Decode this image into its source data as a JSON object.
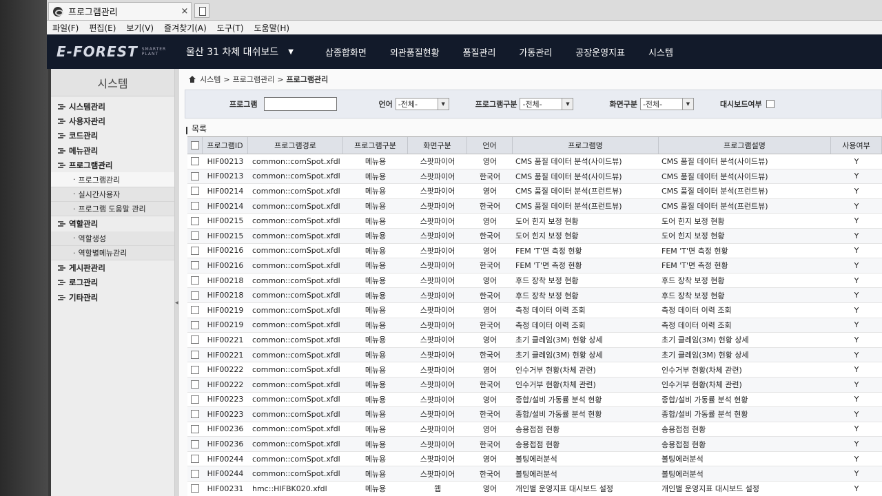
{
  "browser": {
    "tab_title": "프로그램관리",
    "tab_close": "×",
    "menu": [
      "파일(F)",
      "편집(E)",
      "보기(V)",
      "즐겨찾기(A)",
      "도구(T)",
      "도움말(H)"
    ]
  },
  "app": {
    "logo": "E-FOREST",
    "logo_sub_1": "SMARTER",
    "logo_sub_2": "PLANT",
    "dashboard": "울산 31 차체 대쉬보드",
    "nav": [
      "삽종합화면",
      "외관품질현황",
      "품질관리",
      "가동관리",
      "공장운영지표",
      "시스템"
    ]
  },
  "sidebar": {
    "title": "시스템",
    "items": [
      {
        "label": "시스템관리",
        "level": 1
      },
      {
        "label": "사용자관리",
        "level": 1
      },
      {
        "label": "코드관리",
        "level": 1
      },
      {
        "label": "메뉴관리",
        "level": 1
      },
      {
        "label": "프로그램관리",
        "level": 1
      },
      {
        "label": "프로그램관리",
        "level": 2,
        "active": true
      },
      {
        "label": "실시간사용자",
        "level": 2
      },
      {
        "label": "프로그램 도움말 관리",
        "level": 2
      },
      {
        "label": "역할관리",
        "level": 1
      },
      {
        "label": "역할생성",
        "level": 2
      },
      {
        "label": "역할별메뉴관리",
        "level": 2
      },
      {
        "label": "게시판관리",
        "level": 1
      },
      {
        "label": "로그관리",
        "level": 1
      },
      {
        "label": "기타관리",
        "level": 1
      }
    ]
  },
  "breadcrumb": {
    "a": "시스템",
    "b": "프로그램관리",
    "c": "프로그램관리",
    "sep": ">"
  },
  "search": {
    "program_label": "프로그램",
    "program_value": "",
    "lang_label": "언어",
    "lang_value": "-전체-",
    "ptype_label": "프로그램구분",
    "ptype_value": "-전체-",
    "screen_label": "화면구분",
    "screen_value": "-전체-",
    "dash_label": "대시보드여부"
  },
  "list": {
    "title": "목록",
    "headers": [
      "프로그램ID",
      "프로그램경로",
      "프로그램구분",
      "화면구분",
      "언어",
      "프로그램명",
      "프로그램설명",
      "사용여부"
    ],
    "rows": [
      [
        "HIF00213",
        "common::comSpot.xfdl",
        "메뉴용",
        "스팟파이어",
        "영어",
        "CMS 품질 데이터 분석(사이드뷰)",
        "CMS 품질 데이터 분석(사이드뷰)",
        "Y"
      ],
      [
        "HIF00213",
        "common::comSpot.xfdl",
        "메뉴용",
        "스팟파이어",
        "한국어",
        "CMS 품질 데이터 분석(사이드뷰)",
        "CMS 품질 데이터 분석(사이드뷰)",
        "Y"
      ],
      [
        "HIF00214",
        "common::comSpot.xfdl",
        "메뉴용",
        "스팟파이어",
        "영어",
        "CMS 품질 데이터 분석(프런트뷰)",
        "CMS 품질 데이터 분석(프런트뷰)",
        "Y"
      ],
      [
        "HIF00214",
        "common::comSpot.xfdl",
        "메뉴용",
        "스팟파이어",
        "한국어",
        "CMS 품질 데이터 분석(프런트뷰)",
        "CMS 품질 데이터 분석(프런트뷰)",
        "Y"
      ],
      [
        "HIF00215",
        "common::comSpot.xfdl",
        "메뉴용",
        "스팟파이어",
        "영어",
        "도어 힌지 보정 현황",
        "도어 힌지 보정 현황",
        "Y"
      ],
      [
        "HIF00215",
        "common::comSpot.xfdl",
        "메뉴용",
        "스팟파이어",
        "한국어",
        "도어 힌지 보정 현황",
        "도어 힌지 보정 현황",
        "Y"
      ],
      [
        "HIF00216",
        "common::comSpot.xfdl",
        "메뉴용",
        "스팟파이어",
        "영어",
        "FEM 'T'면 측정 현황",
        "FEM 'T'면 측정 현황",
        "Y"
      ],
      [
        "HIF00216",
        "common::comSpot.xfdl",
        "메뉴용",
        "스팟파이어",
        "한국어",
        "FEM 'T'면 측정 현황",
        "FEM 'T'면 측정 현황",
        "Y"
      ],
      [
        "HIF00218",
        "common::comSpot.xfdl",
        "메뉴용",
        "스팟파이어",
        "영어",
        "후드 장착 보정 현황",
        "후드 장착 보정 현황",
        "Y"
      ],
      [
        "HIF00218",
        "common::comSpot.xfdl",
        "메뉴용",
        "스팟파이어",
        "한국어",
        "후드 장착 보정 현황",
        "후드 장착 보정 현황",
        "Y"
      ],
      [
        "HIF00219",
        "common::comSpot.xfdl",
        "메뉴용",
        "스팟파이어",
        "영어",
        "측정 데이터 이력 조회",
        "측정 데이터 이력 조회",
        "Y"
      ],
      [
        "HIF00219",
        "common::comSpot.xfdl",
        "메뉴용",
        "스팟파이어",
        "한국어",
        "측정 데이터 이력 조회",
        "측정 데이터 이력 조회",
        "Y"
      ],
      [
        "HIF00221",
        "common::comSpot.xfdl",
        "메뉴용",
        "스팟파이어",
        "영어",
        "초기 클레임(3M) 현황 상세",
        "초기 클레임(3M) 현황 상세",
        "Y"
      ],
      [
        "HIF00221",
        "common::comSpot.xfdl",
        "메뉴용",
        "스팟파이어",
        "한국어",
        "초기 클레임(3M) 현황 상세",
        "초기 클레임(3M) 현황 상세",
        "Y"
      ],
      [
        "HIF00222",
        "common::comSpot.xfdl",
        "메뉴용",
        "스팟파이어",
        "영어",
        "인수거부 현황(차체 관련)",
        "인수거부 현황(차체 관련)",
        "Y"
      ],
      [
        "HIF00222",
        "common::comSpot.xfdl",
        "메뉴용",
        "스팟파이어",
        "한국어",
        "인수거부 현황(차체 관련)",
        "인수거부 현황(차체 관련)",
        "Y"
      ],
      [
        "HIF00223",
        "common::comSpot.xfdl",
        "메뉴용",
        "스팟파이어",
        "영어",
        "종합/설비 가동률 분석 현황",
        "종합/설비 가동률 분석 현황",
        "Y"
      ],
      [
        "HIF00223",
        "common::comSpot.xfdl",
        "메뉴용",
        "스팟파이어",
        "한국어",
        "종합/설비 가동률 분석 현황",
        "종합/설비 가동률 분석 현황",
        "Y"
      ],
      [
        "HIF00236",
        "common::comSpot.xfdl",
        "메뉴용",
        "스팟파이어",
        "영어",
        "송용접점 현황",
        "송용접점 현황",
        "Y"
      ],
      [
        "HIF00236",
        "common::comSpot.xfdl",
        "메뉴용",
        "스팟파이어",
        "한국어",
        "송용접점 현황",
        "송용접점 현황",
        "Y"
      ],
      [
        "HIF00244",
        "common::comSpot.xfdl",
        "메뉴용",
        "스팟파이어",
        "영어",
        "볼팅에러분석",
        "볼팅에러분석",
        "Y"
      ],
      [
        "HIF00244",
        "common::comSpot.xfdl",
        "메뉴용",
        "스팟파이어",
        "한국어",
        "볼팅에러분석",
        "볼팅에러분석",
        "Y"
      ],
      [
        "HIF00231",
        "hmc::HIFBK020.xfdl",
        "메뉴용",
        "웹",
        "영어",
        "개인별 운영지표 대시보드 설정",
        "개인별 운영지표 대시보드 설정",
        "Y"
      ]
    ]
  }
}
